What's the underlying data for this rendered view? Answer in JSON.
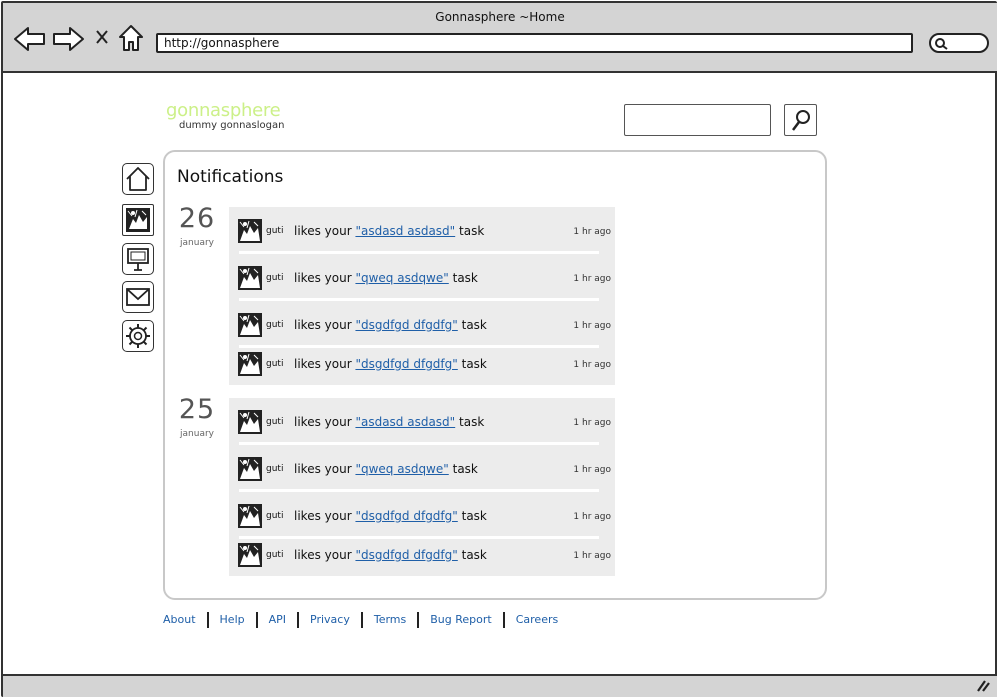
{
  "window": {
    "title": "Gonnasphere ~Home",
    "url": "http://gonnasphere"
  },
  "brand": {
    "logo": "gonnasphere",
    "slogan": "dummy gonnaslogan",
    "logo_color": "#ccf088",
    "link_color": "#1f5fa8"
  },
  "search": {
    "placeholder": ""
  },
  "sidebar": {
    "items": [
      {
        "icon": "home-icon"
      },
      {
        "icon": "profile-image-icon"
      },
      {
        "icon": "presentation-icon"
      },
      {
        "icon": "mail-icon"
      },
      {
        "icon": "settings-icon"
      }
    ]
  },
  "main": {
    "title": "Notifications"
  },
  "notifications": [
    {
      "day": "26",
      "month": "january",
      "items": [
        {
          "user": "guti",
          "before": "likes your",
          "link": "\"asdasd asdasd\"",
          "after": "task",
          "time": "1 hr ago"
        },
        {
          "user": "guti",
          "before": "likes your",
          "link": "\"qweq asdqwe\"",
          "after": "task",
          "time": "1 hr ago"
        },
        {
          "user": "guti",
          "before": "likes your",
          "link": "\"dsgdfgd dfgdfg\"",
          "after": "task",
          "time": "1 hr ago"
        },
        {
          "user": "guti",
          "before": "likes your",
          "link": "\"dsgdfgd dfgdfg\"",
          "after": "task",
          "time": "1 hr ago"
        }
      ]
    },
    {
      "day": "25",
      "month": "january",
      "items": [
        {
          "user": "guti",
          "before": "likes your",
          "link": "\"asdasd asdasd\"",
          "after": "task",
          "time": "1 hr ago"
        },
        {
          "user": "guti",
          "before": "likes your",
          "link": "\"qweq asdqwe\"",
          "after": "task",
          "time": "1 hr ago"
        },
        {
          "user": "guti",
          "before": "likes your",
          "link": "\"dsgdfgd dfgdfg\"",
          "after": "task",
          "time": "1 hr ago"
        },
        {
          "user": "guti",
          "before": "likes your",
          "link": "\"dsgdfgd dfgdfg\"",
          "after": "task",
          "time": "1 hr ago"
        }
      ]
    }
  ],
  "footer": {
    "links": [
      "About",
      "Help",
      "API",
      "Privacy",
      "Terms",
      "Bug Report",
      "Careers"
    ]
  }
}
